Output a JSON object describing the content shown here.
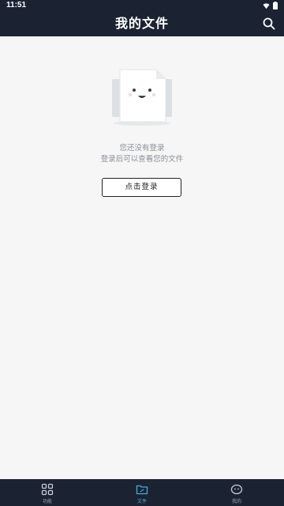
{
  "status_bar": {
    "time": "11:51",
    "icons": [
      "wifi-icon",
      "battery-icon"
    ]
  },
  "app_bar": {
    "title": "我的文件",
    "search_icon": "search-icon"
  },
  "empty_state": {
    "illustration": "smiling-document-illustration",
    "line1": "您还没有登录",
    "line2": "登录后可以查看您的文件",
    "login_button_label": "点击登录"
  },
  "bottom_nav": {
    "items": [
      {
        "label": "功能",
        "icon": "grid-icon",
        "active": false
      },
      {
        "label": "文件",
        "icon": "folder-icon",
        "active": true
      },
      {
        "label": "我的",
        "icon": "profile-face-icon",
        "active": false
      }
    ],
    "active_color": "#4aa8e0",
    "inactive_color": "#9aa3b3"
  },
  "colors": {
    "header_bg": "#1b2333",
    "page_bg": "#f6f6f6",
    "text_muted": "#8a8f99"
  }
}
